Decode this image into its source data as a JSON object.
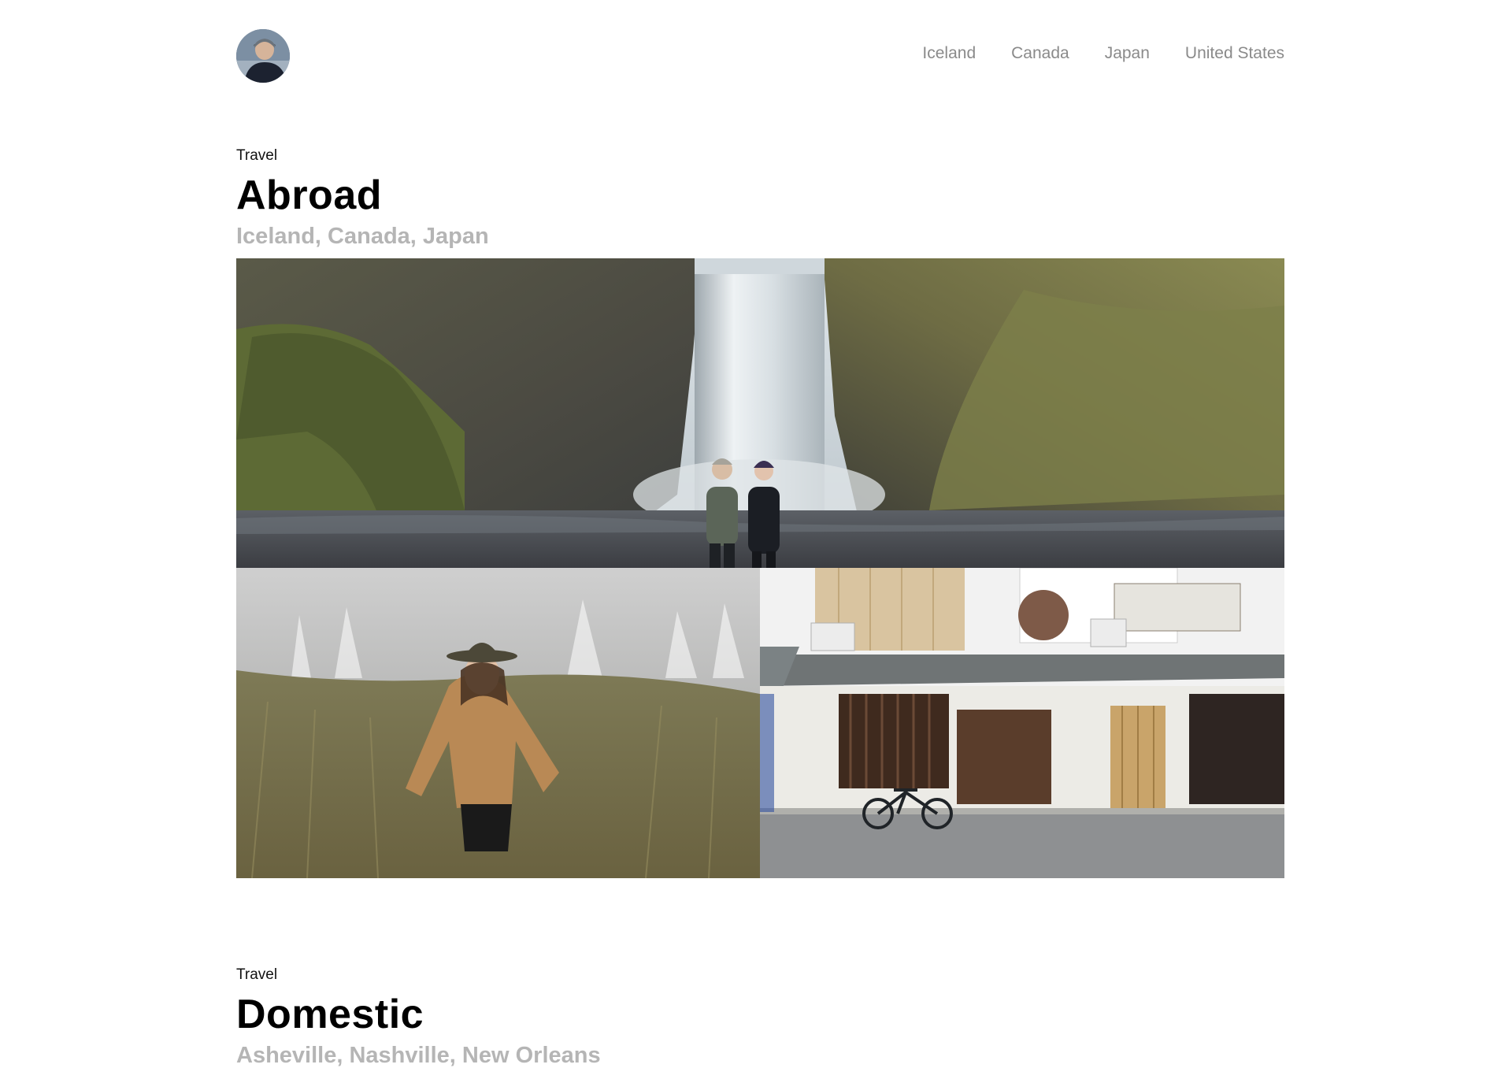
{
  "header": {
    "avatar_alt": "Profile photo",
    "nav": [
      "Iceland",
      "Canada",
      "Japan",
      "United States"
    ]
  },
  "sections": [
    {
      "eyebrow": "Travel",
      "title": "Abroad",
      "subtitle": "Iceland, Canada, Japan"
    },
    {
      "eyebrow": "Travel",
      "title": "Domestic",
      "subtitle": "Asheville, Nashville, New Orleans"
    }
  ],
  "colors": {
    "nav_text": "#8a8a8a",
    "subtitle_text": "#b5b5b5",
    "title_text": "#000000"
  }
}
